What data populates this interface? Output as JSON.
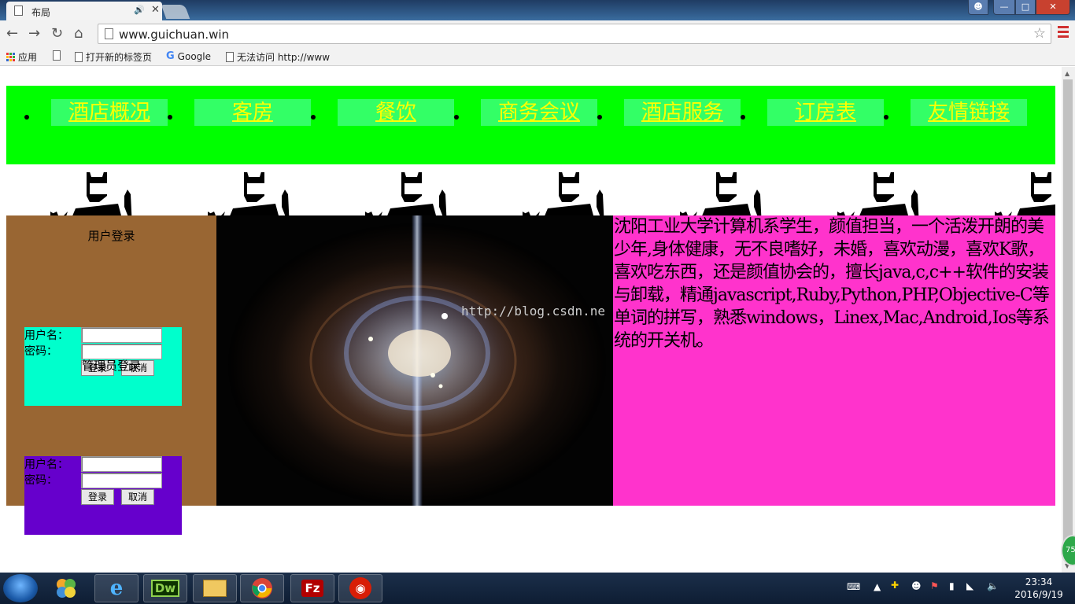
{
  "browser": {
    "tab_title": "布局",
    "url": "www.guichuan.win",
    "bookmarks": [
      {
        "label": "应用",
        "icon": "apps-icon"
      },
      {
        "label": "",
        "icon": "page-icon"
      },
      {
        "label": "打开新的标签页",
        "icon": "page-icon"
      },
      {
        "label": "Google",
        "icon": "google-icon"
      },
      {
        "label": "无法访问 http://www",
        "icon": "page-icon"
      }
    ]
  },
  "nav": {
    "items": [
      "酒店概况",
      "客房",
      "餐饮",
      "商务会议",
      "酒店服务",
      "订房表",
      "友情链接"
    ],
    "bg_color": "#00ff00",
    "link_bg_color": "#33ff66",
    "link_text_color": "#ffff00"
  },
  "user_login": {
    "title": "用户登录",
    "username_label": "用户名：",
    "password_label": "密码：",
    "login_button": "登录",
    "cancel_button": "取消",
    "box_color": "#00ffcc"
  },
  "admin_login": {
    "title": "管理员登录",
    "username_label": "用户名：",
    "password_label": "密码：",
    "login_button": "登录",
    "cancel_button": "取消",
    "box_color": "#6600cc"
  },
  "sidebar_color": "#996633",
  "watermark": "http://blog.csdn.ne",
  "bio": {
    "text": "沈阳工业大学计算机系学生，颜值担当，一个活泼开朗的美少年,身体健康，无不良嗜好，未婚，喜欢动漫，喜欢K歌，喜欢吃东西，还是颜值协会的，擅长java,c,c++软件的安装与卸载，精通javascript,Ruby,Python,PHP,Objective-C等单词的拼写，熟悉windows，Linex,Mac,Android,Ios等系统的开关机。",
    "bg_color": "#ff33cc"
  },
  "taskbar": {
    "time": "23:34",
    "date": "2016/9/19",
    "apps": [
      "ie-icon",
      "dreamweaver-icon",
      "file-explorer-icon",
      "chrome-icon",
      "filezilla-icon",
      "netease-music-icon"
    ],
    "dw_label": "Dw",
    "fz_label": "Fz"
  },
  "float_ball": "75"
}
